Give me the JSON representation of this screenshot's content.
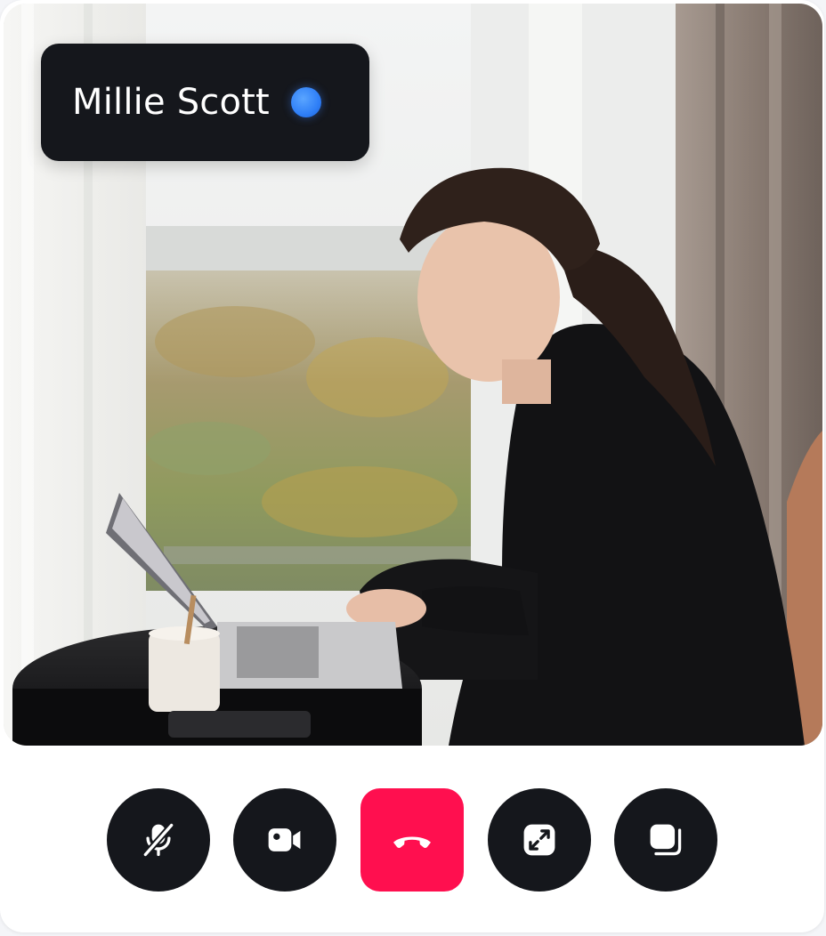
{
  "participant": {
    "name": "Millie Scott",
    "status_color": "#2f7ff7"
  },
  "video": {
    "description_icon": "video-feed"
  },
  "controls": [
    {
      "id": "mute",
      "icon": "microphone-off-icon"
    },
    {
      "id": "camera",
      "icon": "video-camera-icon"
    },
    {
      "id": "end-call",
      "icon": "phone-hangup-icon",
      "color": "#ff0f4f"
    },
    {
      "id": "fullscreen",
      "icon": "expand-icon"
    },
    {
      "id": "picture-in-picture",
      "icon": "layers-icon"
    }
  ],
  "colors": {
    "control_bg": "#15171c",
    "end_call": "#ff0f4f",
    "card_bg": "#ffffff"
  }
}
